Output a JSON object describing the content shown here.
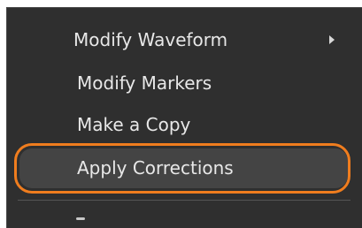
{
  "context_menu": {
    "items": [
      {
        "label": "Modify Waveform",
        "has_submenu": true,
        "icon": "chevron-right-icon"
      },
      {
        "label": "Modify Markers",
        "has_submenu": false
      },
      {
        "label": "Make a Copy",
        "has_submenu": false
      },
      {
        "label": "Apply Corrections",
        "has_submenu": false,
        "highlighted": true
      }
    ],
    "colors": {
      "background": "#2f2f2f",
      "text": "#e8e8e8",
      "hover_background": "#444444",
      "focus_ring": "#f07d1e"
    }
  }
}
